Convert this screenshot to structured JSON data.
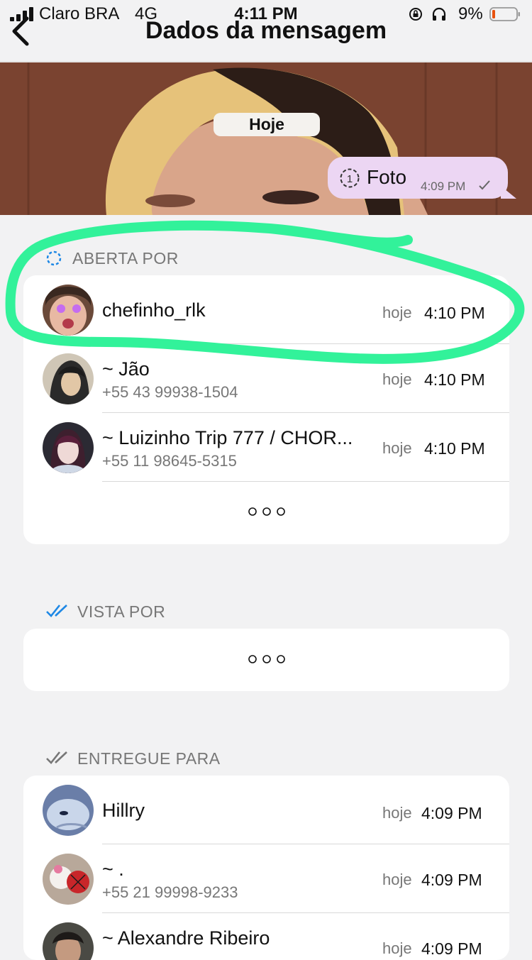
{
  "status_bar": {
    "carrier": "Claro BRA",
    "network": "4G",
    "time": "4:11 PM",
    "battery": "9%"
  },
  "nav": {
    "title": "Dados da mensagem",
    "back_icon": "chevron-left-icon"
  },
  "preview": {
    "date_pill": "Hoje",
    "message": {
      "label": "Foto",
      "time": "4:09 PM",
      "icon": "view-once-icon",
      "status_icon": "single-check-icon"
    }
  },
  "sections": {
    "opened_by": {
      "header": "ABERTA POR",
      "icon": "view-once-dashed-icon",
      "rows": [
        {
          "name": "chefinho_rlk",
          "phone": "",
          "day": "hoje",
          "time": "4:10 PM"
        },
        {
          "name": "~ Jão",
          "phone": "+55 43 99938-1504",
          "day": "hoje",
          "time": "4:10 PM"
        },
        {
          "name": "~ Luizinho Trip 777 / CHOR...",
          "phone": "+55 11 98645-5315",
          "day": "hoje",
          "time": "4:10 PM"
        }
      ],
      "more_icon": "more-dots-icon"
    },
    "viewed_by": {
      "header": "VISTA POR",
      "icon": "double-check-blue-icon",
      "more_icon": "more-dots-icon"
    },
    "delivered_to": {
      "header": "ENTREGUE PARA",
      "icon": "double-check-gray-icon",
      "rows": [
        {
          "name": "Hillry",
          "phone": "",
          "day": "hoje",
          "time": "4:09 PM"
        },
        {
          "name": "~ .",
          "phone": "+55 21 99998-9233",
          "day": "hoje",
          "time": "4:09 PM"
        },
        {
          "name": "~ Alexandre Ribeiro",
          "phone": "",
          "day": "hoje",
          "time": "4:09 PM"
        }
      ]
    }
  },
  "colors": {
    "accent_blue": "#1e88e5",
    "highlight_green": "#32f29a",
    "bubble": "#ecd6f3",
    "background": "#f2f2f3"
  }
}
